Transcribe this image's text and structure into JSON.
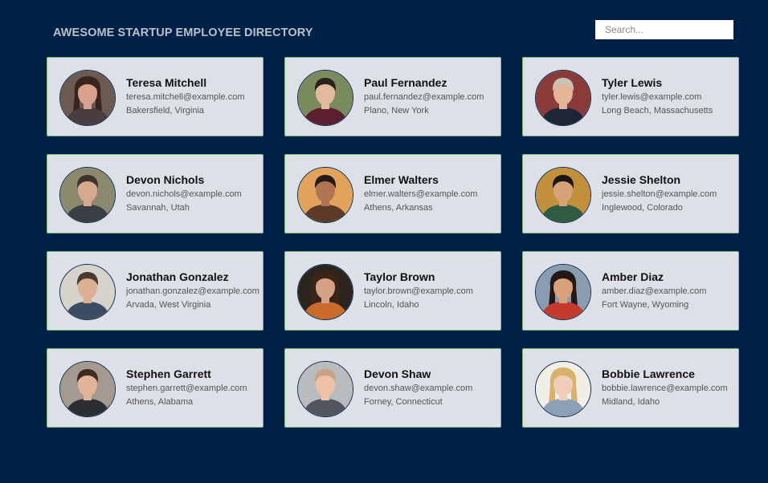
{
  "header": {
    "title": "AWESOME STARTUP EMPLOYEE DIRECTORY",
    "search_placeholder": "Search..."
  },
  "employees": [
    {
      "name": "Teresa Mitchell",
      "email": "teresa.mitchell@example.com",
      "location": "Bakersfield, Virginia",
      "photo": {
        "bg": "#6b5a52",
        "skin": "#d9a28e",
        "hair": "#3a2420",
        "shirt": "#4a3d40"
      }
    },
    {
      "name": "Paul Fernandez",
      "email": "paul.fernandez@example.com",
      "location": "Plano, New York",
      "photo": {
        "bg": "#7a8b5d",
        "skin": "#e2b99d",
        "hair": "#2c221d",
        "shirt": "#5b1f2f"
      }
    },
    {
      "name": "Tyler Lewis",
      "email": "tyler.lewis@example.com",
      "location": "Long Beach, Massachusetts",
      "photo": {
        "bg": "#8b3a3a",
        "skin": "#e4b497",
        "hair": "#c9c2b5",
        "shirt": "#1d2538"
      }
    },
    {
      "name": "Devon Nichols",
      "email": "devon.nichols@example.com",
      "location": "Savannah, Utah",
      "photo": {
        "bg": "#8b8a6e",
        "skin": "#d6a98d",
        "hair": "#3f342b",
        "shirt": "#3a3e45"
      }
    },
    {
      "name": "Elmer Walters",
      "email": "elmer.walters@example.com",
      "location": "Athens, Arkansas",
      "photo": {
        "bg": "#e1a35c",
        "skin": "#b07552",
        "hair": "#241b16",
        "shirt": "#5d3a25"
      }
    },
    {
      "name": "Jessie Shelton",
      "email": "jessie.shelton@example.com",
      "location": "Inglewood, Colorado",
      "photo": {
        "bg": "#c28f3a",
        "skin": "#d7a277",
        "hair": "#1b1613",
        "shirt": "#2f5b45"
      }
    },
    {
      "name": "Jonathan Gonzalez",
      "email": "jonathan.gonzalez@example.com",
      "location": "Arvada, West Virginia",
      "photo": {
        "bg": "#d5d3cc",
        "skin": "#dcae93",
        "hair": "#4a3a2e",
        "shirt": "#3b4d63"
      }
    },
    {
      "name": "Taylor Brown",
      "email": "taylor.brown@example.com",
      "location": "Lincoln, Idaho",
      "photo": {
        "bg": "#2e241e",
        "skin": "#d6a184",
        "hair": "#3b2519",
        "shirt": "#c96b2a"
      }
    },
    {
      "name": "Amber Diaz",
      "email": "amber.diaz@example.com",
      "location": "Fort Wayne, Wyoming",
      "photo": {
        "bg": "#8a9cb0",
        "skin": "#d8a17c",
        "hair": "#231914",
        "shirt": "#c53a2d"
      }
    },
    {
      "name": "Stephen Garrett",
      "email": "stephen.garrett@example.com",
      "location": "Athens, Alabama",
      "photo": {
        "bg": "#a49a92",
        "skin": "#e1b49a",
        "hair": "#3f2b22",
        "shirt": "#2b2e33"
      }
    },
    {
      "name": "Devon Shaw",
      "email": "devon.shaw@example.com",
      "location": "Forney, Connecticut",
      "photo": {
        "bg": "#b9bcbf",
        "skin": "#eec1a8",
        "hair": "#c8a285",
        "shirt": "#505560"
      }
    },
    {
      "name": "Bobbie Lawrence",
      "email": "bobbie.lawrence@example.com",
      "location": "Midland, Idaho",
      "photo": {
        "bg": "#f1eee8",
        "skin": "#efcdb6",
        "hair": "#d8b26a",
        "shirt": "#8aa0b5"
      }
    }
  ]
}
